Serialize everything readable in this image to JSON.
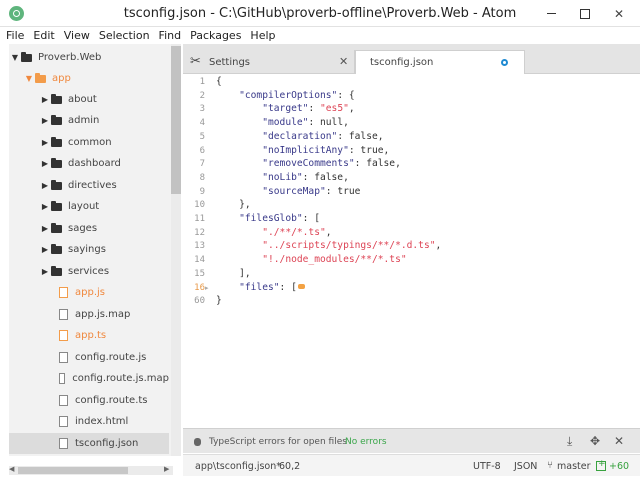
{
  "window": {
    "title": "tsconfig.json - C:\\GitHub\\proverb-offline\\Proverb.Web - Atom",
    "app_icon": "atom-icon",
    "controls": [
      "minimize-icon",
      "maximize-icon",
      "close-icon"
    ],
    "close_glyph": "✕"
  },
  "menu": [
    "File",
    "Edit",
    "View",
    "Selection",
    "Find",
    "Packages",
    "Help"
  ],
  "tree": {
    "root": "Proverb.Web",
    "app_folder": "app",
    "items": [
      {
        "label": "about",
        "kind": "folder"
      },
      {
        "label": "admin",
        "kind": "folder"
      },
      {
        "label": "common",
        "kind": "folder"
      },
      {
        "label": "dashboard",
        "kind": "folder"
      },
      {
        "label": "directives",
        "kind": "folder"
      },
      {
        "label": "layout",
        "kind": "folder"
      },
      {
        "label": "sages",
        "kind": "folder"
      },
      {
        "label": "sayings",
        "kind": "folder"
      },
      {
        "label": "services",
        "kind": "folder"
      },
      {
        "label": "app.js",
        "kind": "file",
        "status": "modified"
      },
      {
        "label": "app.js.map",
        "kind": "file"
      },
      {
        "label": "app.ts",
        "kind": "file",
        "status": "modified"
      },
      {
        "label": "config.route.js",
        "kind": "file"
      },
      {
        "label": "config.route.js.map",
        "kind": "file"
      },
      {
        "label": "config.route.ts",
        "kind": "file"
      },
      {
        "label": "index.html",
        "kind": "file"
      },
      {
        "label": "tsconfig.json",
        "kind": "file",
        "selected": true
      }
    ],
    "arrow_glyph": "▶",
    "arrow_open_glyph": "▼",
    "scroll_left_glyph": "◀"
  },
  "tabs": [
    {
      "label": "Settings",
      "icon": "tools-icon",
      "glyph": "✕"
    },
    {
      "label": "tsconfig.json",
      "active": true,
      "modified": true
    }
  ],
  "editor": {
    "line_numbers": [
      "1",
      "2",
      "3",
      "4",
      "5",
      "6",
      "7",
      "8",
      "9",
      "10",
      "11",
      "12",
      "13",
      "14",
      "15",
      "16",
      "60"
    ],
    "fold_glyph": "▸",
    "lines": [
      "{",
      "    \"compilerOptions\": {",
      "        \"target\": \"es5\",",
      "        \"module\": null,",
      "        \"declaration\": false,",
      "        \"noImplicitAny\": true,",
      "        \"removeComments\": false,",
      "        \"noLib\": false,",
      "        \"sourceMap\": true",
      "    },",
      "    \"filesGlob\": [",
      "        \"./**/*.ts\",",
      "        \"../scripts/typings/**/*.d.ts\",",
      "        \"!./node_modules/**/*.ts\"",
      "    ],",
      "    \"files\": [",
      "}"
    ]
  },
  "panel": {
    "icon": "bug-icon",
    "label": "TypeScript errors for open files",
    "status": "No errors",
    "buttons": [
      "download-icon",
      "move-icon",
      "close-icon"
    ],
    "download_glyph": "⤓",
    "move_glyph": "✥",
    "close_glyph": "✕"
  },
  "statusbar": {
    "path": "app\\tsconfig.json*",
    "cursor": "60,2",
    "encoding": "UTF-8",
    "grammar": "JSON",
    "branch": "master",
    "branch_icon": "git-branch-icon",
    "branch_glyph": "⑂",
    "diff": "+60",
    "status_color": "#38a23f"
  },
  "colors": {
    "accent": "#1f8ad2",
    "modified": "#f0883e",
    "string": "#dd4455",
    "key": "#3a3a8a"
  }
}
